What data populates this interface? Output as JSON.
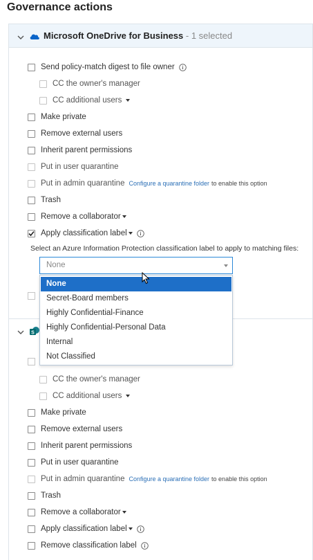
{
  "page": {
    "title": "Governance actions"
  },
  "panel1": {
    "title": "Microsoft OneDrive for Business",
    "selected": " - 1 selected",
    "icons": {
      "collapse": "chevron-down-icon",
      "service": "onedrive-cloud-icon"
    },
    "accent_color": "#1e6fc8",
    "actions": [
      {
        "label": "Send policy-match digest to file owner",
        "checked": false,
        "disabled": false,
        "info": true
      },
      {
        "label": "CC the owner's manager",
        "checked": false,
        "disabled": true
      },
      {
        "label": "CC additional users",
        "checked": false,
        "disabled": true,
        "caret": true
      },
      {
        "label": "Make private",
        "checked": false,
        "disabled": false
      },
      {
        "label": "Remove external users",
        "checked": false,
        "disabled": false
      },
      {
        "label": "Inherit parent permissions",
        "checked": false,
        "disabled": false
      },
      {
        "label": "Put in user quarantine",
        "checked": false,
        "disabled": true
      },
      {
        "label": "Put in admin quarantine",
        "checked": false,
        "disabled": true,
        "link": "Configure a quarantine folder",
        "suffix": "to enable this option"
      },
      {
        "label": "Trash",
        "checked": false,
        "disabled": false
      },
      {
        "label": "Remove a collaborator",
        "checked": false,
        "disabled": false,
        "caret": true
      },
      {
        "label": "Apply classification label",
        "checked": true,
        "disabled": false,
        "caret": true,
        "info": true
      }
    ],
    "classification_prompt": "Select an Azure Information Protection classification label to apply to matching files:",
    "select": {
      "value": "None"
    },
    "dropdown_options": [
      "None",
      "Secret-Board members",
      "Highly Confidential-Finance",
      "Highly Confidential-Personal Data",
      "Internal",
      "Not Classified"
    ]
  },
  "panel2": {
    "icons": {
      "collapse": "chevron-down-icon",
      "service": "sharepoint-icon"
    },
    "actions": [
      {
        "label": "CC the owner's manager",
        "checked": false,
        "disabled": true
      },
      {
        "label": "CC additional users",
        "checked": false,
        "disabled": true,
        "caret": true
      },
      {
        "label": "Make private",
        "checked": false,
        "disabled": false
      },
      {
        "label": "Remove external users",
        "checked": false,
        "disabled": false
      },
      {
        "label": "Inherit parent permissions",
        "checked": false,
        "disabled": false
      },
      {
        "label": "Put in user quarantine",
        "checked": false,
        "disabled": false
      },
      {
        "label": "Put in admin quarantine",
        "checked": false,
        "disabled": true,
        "link": "Configure a quarantine folder",
        "suffix": "to enable this option"
      },
      {
        "label": "Trash",
        "checked": false,
        "disabled": false
      },
      {
        "label": "Remove a collaborator",
        "checked": false,
        "disabled": false,
        "caret": true
      },
      {
        "label": "Apply classification label",
        "checked": false,
        "disabled": false,
        "caret": true,
        "info": true
      },
      {
        "label": "Remove classification label",
        "checked": false,
        "disabled": false,
        "info": true
      }
    ]
  }
}
